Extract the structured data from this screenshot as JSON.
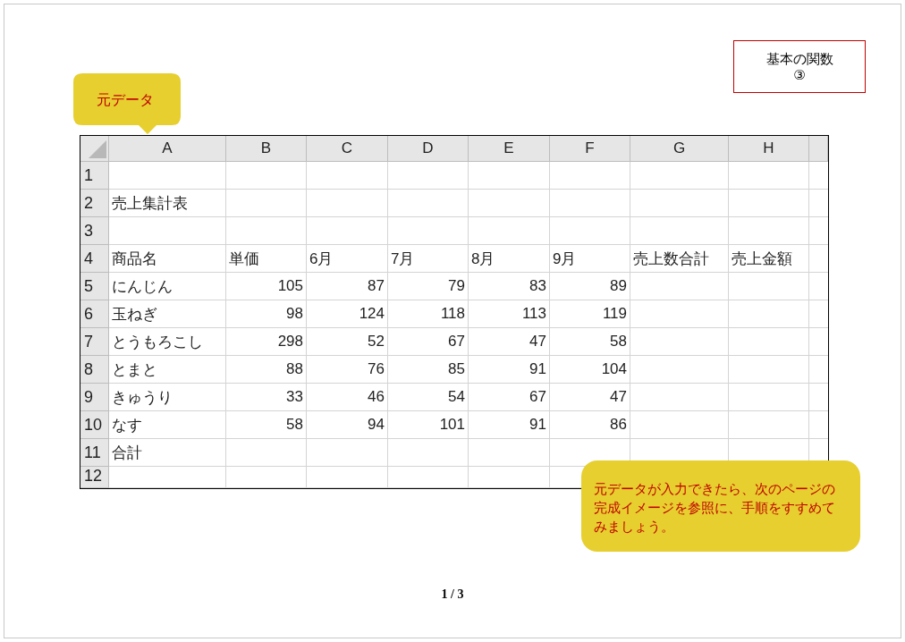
{
  "title_box": {
    "lines": [
      "基本の関数",
      "③"
    ]
  },
  "note_top": {
    "text": "元データ"
  },
  "sheet": {
    "columns": [
      "A",
      "B",
      "C",
      "D",
      "E",
      "F",
      "G",
      "H"
    ],
    "rows": [
      {
        "number": "1",
        "cells": []
      },
      {
        "number": "2",
        "cells": [
          {
            "text": "売上集計表",
            "kind": "label"
          }
        ]
      },
      {
        "number": "3",
        "cells": []
      },
      {
        "number": "4",
        "cells": [
          {
            "text": "商品名",
            "kind": "label"
          },
          {
            "text": "単価",
            "kind": "label"
          },
          {
            "text": "6月",
            "kind": "label"
          },
          {
            "text": "7月",
            "kind": "label"
          },
          {
            "text": "8月",
            "kind": "label"
          },
          {
            "text": "9月",
            "kind": "label"
          },
          {
            "text": "売上数合計",
            "kind": "label"
          },
          {
            "text": "売上金額",
            "kind": "label"
          }
        ]
      },
      {
        "number": "5",
        "cells": [
          {
            "text": "にんじん",
            "kind": "label"
          },
          {
            "text": "105",
            "kind": "number"
          },
          {
            "text": "87",
            "kind": "number"
          },
          {
            "text": "79",
            "kind": "number"
          },
          {
            "text": "83",
            "kind": "number"
          },
          {
            "text": "89",
            "kind": "number"
          }
        ]
      },
      {
        "number": "6",
        "cells": [
          {
            "text": "玉ねぎ",
            "kind": "label"
          },
          {
            "text": "98",
            "kind": "number"
          },
          {
            "text": "124",
            "kind": "number"
          },
          {
            "text": "118",
            "kind": "number"
          },
          {
            "text": "113",
            "kind": "number"
          },
          {
            "text": "119",
            "kind": "number"
          }
        ]
      },
      {
        "number": "7",
        "cells": [
          {
            "text": "とうもろこし",
            "kind": "label"
          },
          {
            "text": "298",
            "kind": "number"
          },
          {
            "text": "52",
            "kind": "number"
          },
          {
            "text": "67",
            "kind": "number"
          },
          {
            "text": "47",
            "kind": "number"
          },
          {
            "text": "58",
            "kind": "number"
          }
        ]
      },
      {
        "number": "8",
        "cells": [
          {
            "text": "とまと",
            "kind": "label"
          },
          {
            "text": "88",
            "kind": "number"
          },
          {
            "text": "76",
            "kind": "number"
          },
          {
            "text": "85",
            "kind": "number"
          },
          {
            "text": "91",
            "kind": "number"
          },
          {
            "text": "104",
            "kind": "number"
          }
        ]
      },
      {
        "number": "9",
        "cells": [
          {
            "text": "きゅうり",
            "kind": "label"
          },
          {
            "text": "33",
            "kind": "number"
          },
          {
            "text": "46",
            "kind": "number"
          },
          {
            "text": "54",
            "kind": "number"
          },
          {
            "text": "67",
            "kind": "number"
          },
          {
            "text": "47",
            "kind": "number"
          }
        ]
      },
      {
        "number": "10",
        "cells": [
          {
            "text": "なす",
            "kind": "label"
          },
          {
            "text": "58",
            "kind": "number"
          },
          {
            "text": "94",
            "kind": "number"
          },
          {
            "text": "101",
            "kind": "number"
          },
          {
            "text": "91",
            "kind": "number"
          },
          {
            "text": "86",
            "kind": "number"
          }
        ]
      },
      {
        "number": "11",
        "cells": [
          {
            "text": "合計",
            "kind": "label"
          }
        ]
      },
      {
        "number": "12",
        "cells": []
      }
    ]
  },
  "note_bottom": {
    "text": "元データが入力できたら、次のページの完成イメージを参照に、手順をすすめてみましょう。"
  },
  "page_number": "1 / 3"
}
